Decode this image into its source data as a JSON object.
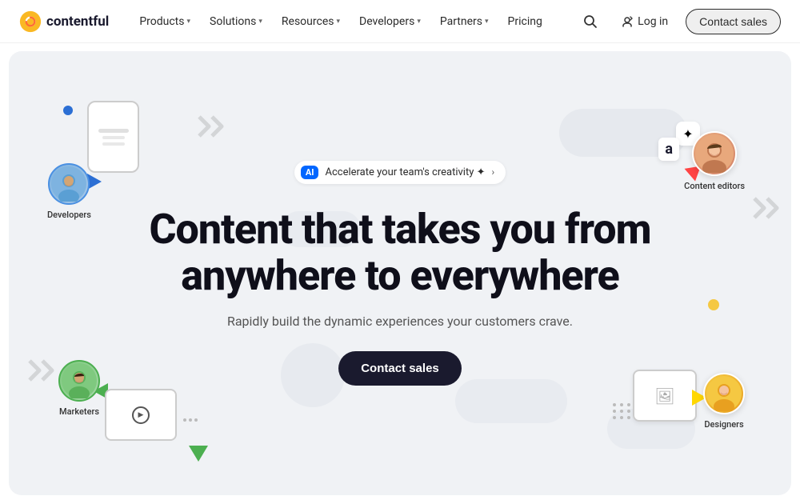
{
  "nav": {
    "logo_text": "contentful",
    "links": [
      {
        "label": "Products",
        "has_dropdown": true
      },
      {
        "label": "Solutions",
        "has_dropdown": true
      },
      {
        "label": "Resources",
        "has_dropdown": true
      },
      {
        "label": "Developers",
        "has_dropdown": true
      },
      {
        "label": "Partners",
        "has_dropdown": true
      },
      {
        "label": "Pricing",
        "has_dropdown": false
      }
    ],
    "login_label": "Log in",
    "contact_label": "Contact sales"
  },
  "hero": {
    "ai_badge_label": "AI",
    "ai_badge_text": "Accelerate your team's creativity ✦",
    "title_line1": "Content that takes you from",
    "title_line2": "anywhere to everywhere",
    "subtitle": "Rapidly build the dynamic experiences your customers crave.",
    "cta_label": "Contact sales",
    "floating": {
      "developers_label": "Developers",
      "editors_label": "Content editors",
      "marketers_label": "Marketers",
      "designers_label": "Designers"
    }
  }
}
